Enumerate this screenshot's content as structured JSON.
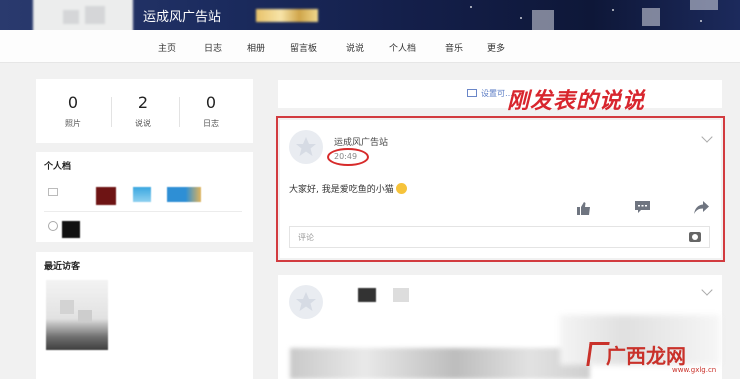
{
  "header": {
    "site_name": "运成风广告站"
  },
  "nav": {
    "items": [
      "主页",
      "日志",
      "相册",
      "留言板",
      "说说",
      "个人档",
      "音乐",
      "更多"
    ]
  },
  "stats": [
    {
      "value": "0",
      "label": "照片"
    },
    {
      "value": "2",
      "label": "说说"
    },
    {
      "value": "0",
      "label": "日志"
    }
  ],
  "sidebar": {
    "profile_title": "个人档",
    "visitors_title": "最近访客"
  },
  "feed": {
    "settings_link": "设置可…",
    "annotation": "刚发表的说说",
    "post": {
      "author": "运成风广告站",
      "time": "20:49",
      "text": "大家好, 我是爱吃鱼的小猫",
      "comment_placeholder": "评论"
    }
  },
  "watermark": {
    "text": "广西龙网",
    "url": "www.gxlg.cn"
  },
  "colors": {
    "annotation_red": "#d8262e",
    "banner_navy": "#141f4a",
    "link_blue": "#5a7bc4"
  },
  "icons": [
    "like-icon",
    "comment-icon",
    "share-icon",
    "camera-icon",
    "chevron-down-icon",
    "settings-icon"
  ]
}
